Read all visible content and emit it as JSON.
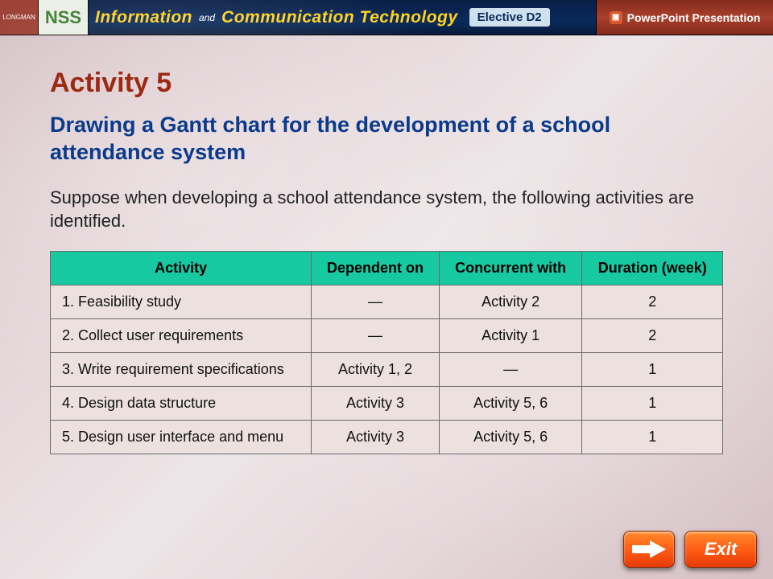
{
  "banner": {
    "logo_small": "LONGMAN",
    "nss": "NSS",
    "title_word1": "Information",
    "title_and": "and",
    "title_word2": "Communication Technology",
    "elective": "Elective D2",
    "ppt": "PowerPoint Presentation"
  },
  "slide": {
    "heading": "Activity 5",
    "subheading": "Drawing a Gantt chart for the development of a school attendance system",
    "lead": "Suppose when developing a school attendance system, the following activities are identified."
  },
  "table": {
    "headers": [
      "Activity",
      "Dependent on",
      "Concurrent with",
      "Duration (week)"
    ],
    "rows": [
      {
        "activity": "1. Feasibility study",
        "dep": "—",
        "conc": "Activity 2",
        "dur": "2"
      },
      {
        "activity": "2. Collect user requirements",
        "dep": "—",
        "conc": "Activity 1",
        "dur": "2"
      },
      {
        "activity": "3. Write requirement specifications",
        "dep": "Activity 1, 2",
        "conc": "—",
        "dur": "1"
      },
      {
        "activity": "4. Design data structure",
        "dep": "Activity 3",
        "conc": "Activity 5, 6",
        "dur": "1"
      },
      {
        "activity": "5. Design user interface and menu",
        "dep": "Activity 3",
        "conc": "Activity 5, 6",
        "dur": "1"
      }
    ]
  },
  "buttons": {
    "exit": "Exit"
  }
}
